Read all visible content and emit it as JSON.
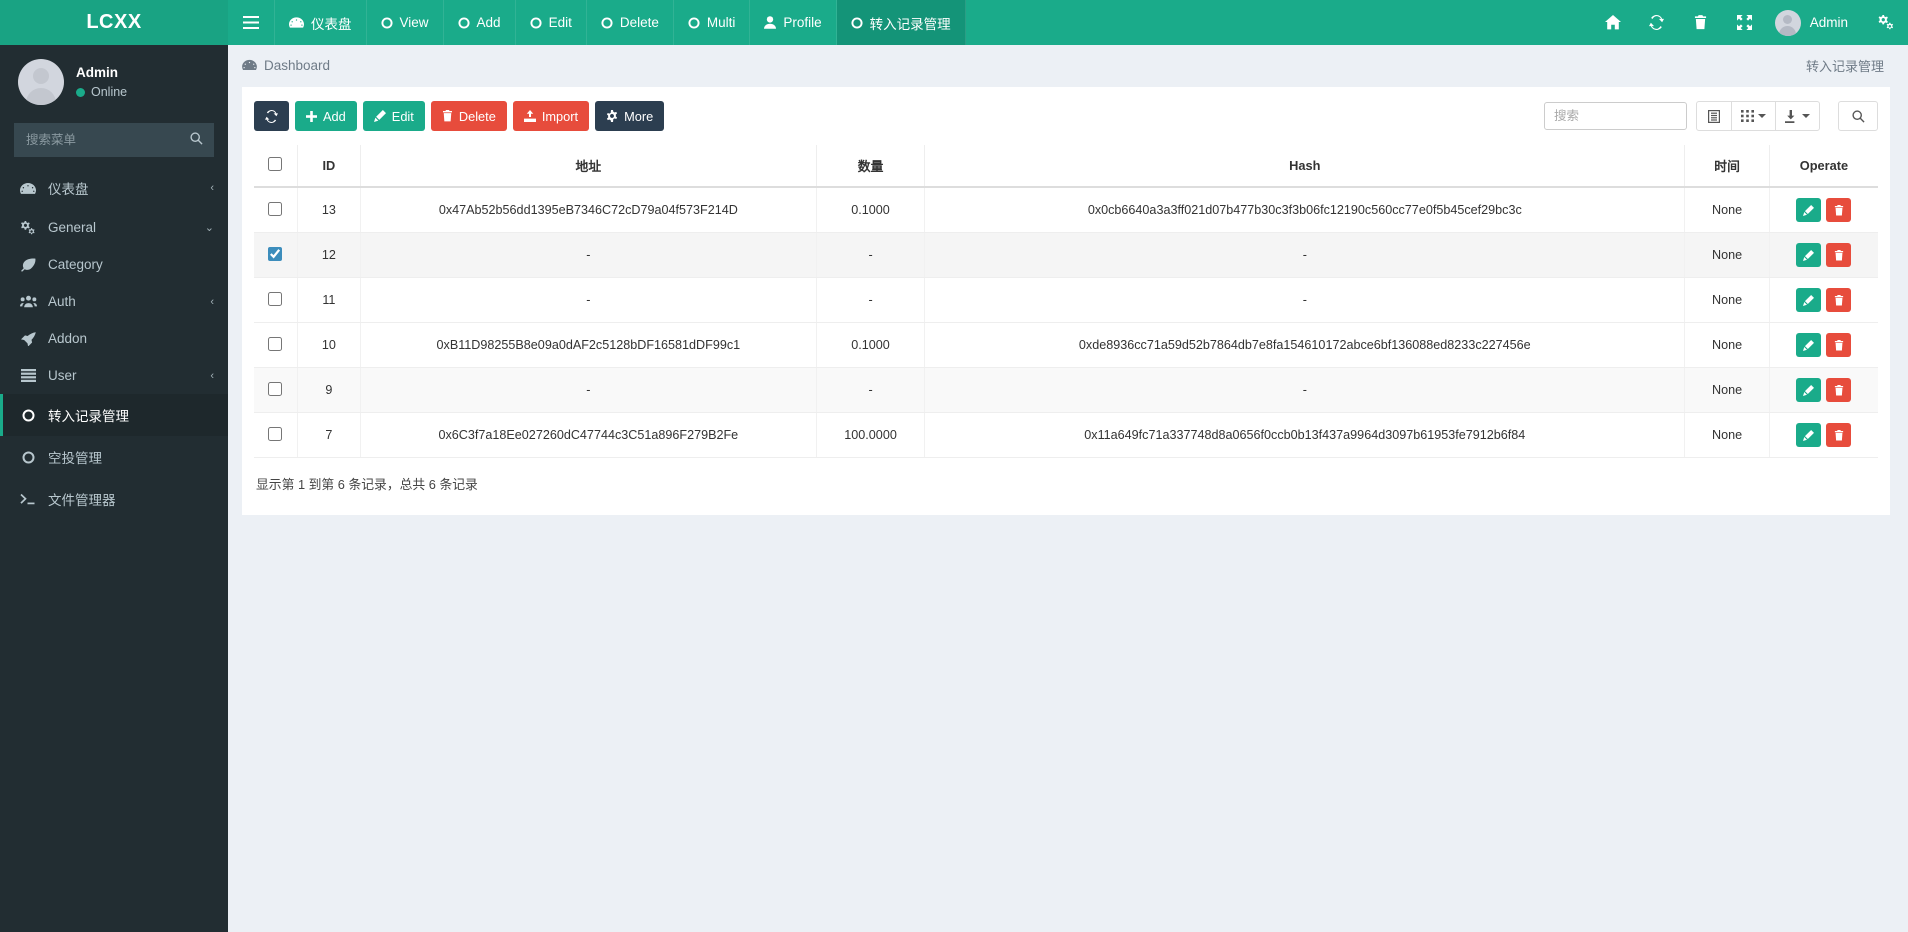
{
  "brand": {
    "title": "LCXX"
  },
  "navbar": {
    "toggle_icon": "hamburger-icon",
    "items": [
      {
        "label": "仪表盘",
        "icon": "dashboard-icon",
        "active": false
      },
      {
        "label": "View",
        "icon": "circle-o-icon",
        "active": false
      },
      {
        "label": "Add",
        "icon": "circle-o-icon",
        "active": false
      },
      {
        "label": "Edit",
        "icon": "circle-o-icon",
        "active": false
      },
      {
        "label": "Delete",
        "icon": "circle-o-icon",
        "active": false
      },
      {
        "label": "Multi",
        "icon": "circle-o-icon",
        "active": false
      },
      {
        "label": "Profile",
        "icon": "user-icon",
        "active": false
      },
      {
        "label": "转入记录管理",
        "icon": "circle-o-icon",
        "active": true
      }
    ],
    "right_icons": [
      {
        "name": "home-icon"
      },
      {
        "name": "refresh-icon"
      },
      {
        "name": "trash-icon"
      },
      {
        "name": "fullscreen-icon"
      }
    ],
    "user": {
      "name": "Admin"
    },
    "settings_icon": "gears-icon"
  },
  "sidebar": {
    "user": {
      "name": "Admin",
      "status": "Online"
    },
    "search": {
      "placeholder": "搜索菜单",
      "value": ""
    },
    "items": [
      {
        "label": "仪表盘",
        "icon": "dashboard-icon",
        "arrow": "‹",
        "active": false
      },
      {
        "label": "General",
        "icon": "gears-icon",
        "arrow": "⌄",
        "active": false
      },
      {
        "label": "Category",
        "icon": "leaf-icon",
        "arrow": "",
        "active": false
      },
      {
        "label": "Auth",
        "icon": "users-icon",
        "arrow": "‹",
        "active": false
      },
      {
        "label": "Addon",
        "icon": "rocket-icon",
        "arrow": "",
        "active": false
      },
      {
        "label": "User",
        "icon": "list-icon",
        "arrow": "‹",
        "active": false
      },
      {
        "label": "转入记录管理",
        "icon": "circle-o-icon",
        "arrow": "",
        "active": true
      },
      {
        "label": "空投管理",
        "icon": "circle-o-icon",
        "arrow": "",
        "active": false
      },
      {
        "label": "文件管理器",
        "icon": "terminal-icon",
        "arrow": "",
        "active": false
      }
    ]
  },
  "content_header": {
    "breadcrumb": "Dashboard",
    "breadcrumb_icon": "dashboard-icon",
    "page_sub": "转入记录管理"
  },
  "toolbar": {
    "refresh_icon": "refresh-icon",
    "buttons": [
      {
        "label": "Add",
        "icon": "plus-icon",
        "style": "teal"
      },
      {
        "label": "Edit",
        "icon": "pencil-icon",
        "style": "teal"
      },
      {
        "label": "Delete",
        "icon": "trash-icon",
        "style": "red"
      },
      {
        "label": "Import",
        "icon": "upload-icon",
        "style": "red"
      },
      {
        "label": "More",
        "icon": "gear-icon",
        "style": "dark"
      }
    ],
    "search": {
      "placeholder": "搜索",
      "value": ""
    },
    "view_icons": [
      {
        "name": "detail-view-icon",
        "caret": false
      },
      {
        "name": "columns-icon",
        "caret": true
      },
      {
        "name": "export-icon",
        "caret": true
      }
    ],
    "search_button_icon": "search-icon"
  },
  "table": {
    "columns": [
      "",
      "ID",
      "地址",
      "数量",
      "Hash",
      "时间",
      "Operate"
    ],
    "rows": [
      {
        "checked": false,
        "id": "13",
        "address": "0x47Ab52b56dd1395eB7346C72cD79a04f573F214D",
        "amount": "0.1000",
        "hash": "0x0cb6640a3a3ff021d07b477b30c3f3b06fc12190c560cc77e0f5b45cef29bc3c",
        "time": "None"
      },
      {
        "checked": true,
        "id": "12",
        "address": "-",
        "amount": "-",
        "hash": "-",
        "time": "None"
      },
      {
        "checked": false,
        "id": "11",
        "address": "-",
        "amount": "-",
        "hash": "-",
        "time": "None"
      },
      {
        "checked": false,
        "id": "10",
        "address": "0xB11D98255B8e09a0dAF2c5128bDF16581dDF99c1",
        "amount": "0.1000",
        "hash": "0xde8936cc71a59d52b7864db7e8fa154610172abce6bf136088ed8233c227456e",
        "time": "None"
      },
      {
        "checked": false,
        "id": "9",
        "address": "-",
        "amount": "-",
        "hash": "-",
        "time": "None"
      },
      {
        "checked": false,
        "id": "7",
        "address": "0x6C3f7a18Ee027260dC47744c3C51a896F279B2Fe",
        "amount": "100.0000",
        "hash": "0x11a649fc71a337748d8a0656f0ccb0b13f437a9964d3097b61953fe7912b6f84",
        "time": "None"
      }
    ],
    "row_actions": [
      {
        "name": "edit-row-button",
        "icon": "pencil-icon"
      },
      {
        "name": "delete-row-button",
        "icon": "trash-icon"
      }
    ],
    "footer": "显示第 1 到第 6 条记录，总共 6 条记录"
  },
  "colors": {
    "brand_teal": "#1aab8a",
    "nav_active": "#149478",
    "sidebar_bg": "#222d32",
    "danger_red": "#e74c3c",
    "dark_navy": "#2c3e50",
    "content_bg": "#ecf0f5"
  }
}
